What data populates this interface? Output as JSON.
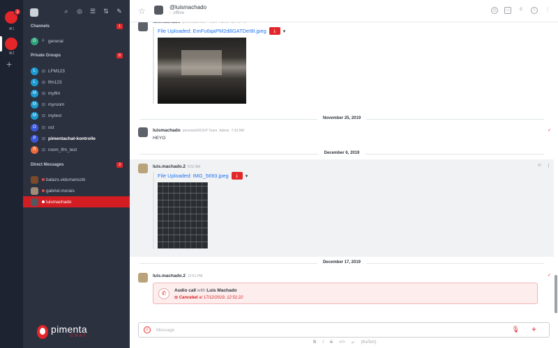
{
  "rail": {
    "servers": [
      {
        "label": "⌘1",
        "badge": "3"
      },
      {
        "label": "⌘2",
        "badge": ""
      }
    ],
    "add": "+"
  },
  "sidebar": {
    "channels_header": "Channels",
    "channels_count": "1",
    "channels": [
      {
        "avatar": "G",
        "color": "#2fa37a",
        "name": "general"
      }
    ],
    "groups_header": "Private Groups",
    "groups_count": "8",
    "groups": [
      {
        "avatar": "L",
        "color": "#1d9bd1",
        "name": "LFM123",
        "bold": false
      },
      {
        "avatar": "L",
        "color": "#1d9bd1",
        "name": "lfm123",
        "bold": false
      },
      {
        "avatar": "M",
        "color": "#1d9bd1",
        "name": "mylfm",
        "bold": false
      },
      {
        "avatar": "M",
        "color": "#1d9bd1",
        "name": "myroom",
        "bold": false
      },
      {
        "avatar": "M",
        "color": "#1d9bd1",
        "name": "mytest",
        "bold": false
      },
      {
        "avatar": "O",
        "color": "#3a57d8",
        "name": "oct",
        "bold": false
      },
      {
        "avatar": "P",
        "color": "#3a57d8",
        "name": "pimentachat-kontrolle",
        "bold": true
      },
      {
        "avatar": "R",
        "color": "#ef6a3a",
        "name": "room_lfm_test",
        "bold": false
      }
    ],
    "dm_header": "Direct Messages",
    "dm_count": "3",
    "dms": [
      {
        "name": "balazs.vidumanszki",
        "active": false
      },
      {
        "name": "gabriel.morais",
        "active": false
      },
      {
        "name": "luismachado",
        "active": true
      }
    ],
    "logo_word": "pimenta",
    "logo_sub": "CHAT"
  },
  "header": {
    "name": "@luismachado",
    "status": "offline"
  },
  "messages": [
    {
      "user": "luismachado",
      "role": "pimentaGROUP Team",
      "admin": "Admin",
      "time": "12:43 PM",
      "file": "File Uploaded: EmFu6qaPM2d8GATDeI8I.jpeg"
    },
    {
      "user": "luismachado",
      "role": "pimentaGROUP Team",
      "admin": "Admin",
      "time": "7:33 AM",
      "text": "HEYO"
    },
    {
      "user": "luis.machado.2",
      "time": "8:52 AM",
      "file": "File Uploaded: IMG_5693.jpeg"
    },
    {
      "user": "luis.machado.2",
      "time": "12:51 PM"
    }
  ],
  "dividers": [
    "November 25, 2019",
    "December 6, 2019",
    "December 17, 2019"
  ],
  "call": {
    "title": "Audio call",
    "with": "with",
    "contact": "Luis Machado",
    "status": "Canceled",
    "at": "at 17/12/2019, 12:51:22"
  },
  "composer": {
    "placeholder": "Message",
    "formatting": [
      "B",
      "I",
      "S",
      "</>",
      "↵",
      "{KaTeX}"
    ]
  }
}
